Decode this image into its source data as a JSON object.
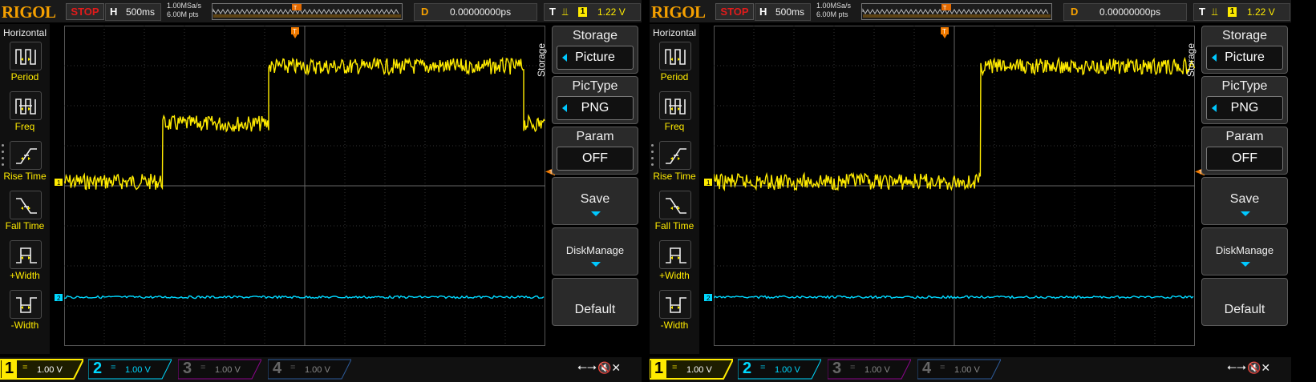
{
  "screens": [
    {
      "brand": "RIGOL",
      "run_state": "STOP",
      "horizontal": {
        "label": "H",
        "timebase": "500ms"
      },
      "sample": {
        "rate": "1.00MSa/s",
        "points": "6.00M pts"
      },
      "delay": {
        "label": "D",
        "value": "0.00000000ps"
      },
      "trigger": {
        "label": "T",
        "edge": "rising",
        "source": "1",
        "level": "1.22 V"
      },
      "left_menu": {
        "title": "Horizontal",
        "items": [
          {
            "label": "Period",
            "icon": "period-icon"
          },
          {
            "label": "Freq",
            "icon": "freq-icon"
          },
          {
            "label": "Rise Time",
            "icon": "rise-time-icon"
          },
          {
            "label": "Fall Time",
            "icon": "fall-time-icon"
          },
          {
            "label": "+Width",
            "icon": "pos-width-icon"
          },
          {
            "label": "-Width",
            "icon": "neg-width-icon"
          }
        ]
      },
      "right_menu": {
        "tab": "Storage",
        "items": [
          {
            "title": "Storage",
            "value": "Picture"
          },
          {
            "title": "PicType",
            "value": "PNG"
          },
          {
            "title": "Param",
            "value": "OFF"
          },
          {
            "title": "Save"
          },
          {
            "title": "DiskManage"
          },
          {
            "title": "Default"
          }
        ]
      },
      "channels": [
        {
          "num": "1",
          "coupling": "=",
          "scale": "1.00 V",
          "color": "#ffeb00",
          "active": true
        },
        {
          "num": "2",
          "coupling": "=",
          "scale": "1.00 V",
          "color": "#00d8ff",
          "active": true
        },
        {
          "num": "3",
          "coupling": "=",
          "scale": "1.00 V",
          "color": "#c000c0",
          "active": false
        },
        {
          "num": "4",
          "coupling": "=",
          "scale": "1.00 V",
          "color": "#3a7bd5",
          "active": false
        }
      ],
      "waveform_ch1_levels": [
        1.0,
        2.26,
        3.5,
        2.26
      ],
      "waveform_ch1_steps_time_div": [
        0,
        2.05,
        4.25,
        9.55,
        10
      ]
    },
    {
      "brand": "RIGOL",
      "run_state": "STOP",
      "horizontal": {
        "label": "H",
        "timebase": "500ms"
      },
      "sample": {
        "rate": "1.00MSa/s",
        "points": "6.00M pts"
      },
      "delay": {
        "label": "D",
        "value": "0.00000000ps"
      },
      "trigger": {
        "label": "T",
        "edge": "rising",
        "source": "1",
        "level": "1.22 V"
      },
      "left_menu": {
        "title": "Horizontal",
        "items": [
          {
            "label": "Period",
            "icon": "period-icon"
          },
          {
            "label": "Freq",
            "icon": "freq-icon"
          },
          {
            "label": "Rise Time",
            "icon": "rise-time-icon"
          },
          {
            "label": "Fall Time",
            "icon": "fall-time-icon"
          },
          {
            "label": "+Width",
            "icon": "pos-width-icon"
          },
          {
            "label": "-Width",
            "icon": "neg-width-icon"
          }
        ]
      },
      "right_menu": {
        "tab": "Storage",
        "items": [
          {
            "title": "Storage",
            "value": "Picture"
          },
          {
            "title": "PicType",
            "value": "PNG"
          },
          {
            "title": "Param",
            "value": "OFF"
          },
          {
            "title": "Save"
          },
          {
            "title": "DiskManage"
          },
          {
            "title": "Default"
          }
        ]
      },
      "channels": [
        {
          "num": "1",
          "coupling": "=",
          "scale": "1.00 V",
          "color": "#ffeb00",
          "active": true
        },
        {
          "num": "2",
          "coupling": "=",
          "scale": "1.00 V",
          "color": "#00d8ff",
          "active": true
        },
        {
          "num": "3",
          "coupling": "=",
          "scale": "1.00 V",
          "color": "#c000c0",
          "active": false
        },
        {
          "num": "4",
          "coupling": "=",
          "scale": "1.00 V",
          "color": "#3a7bd5",
          "active": false
        }
      ],
      "waveform_ch1_levels": [
        1.0,
        3.5
      ],
      "waveform_ch1_steps_time_div": [
        0,
        5.55,
        10
      ]
    }
  ]
}
